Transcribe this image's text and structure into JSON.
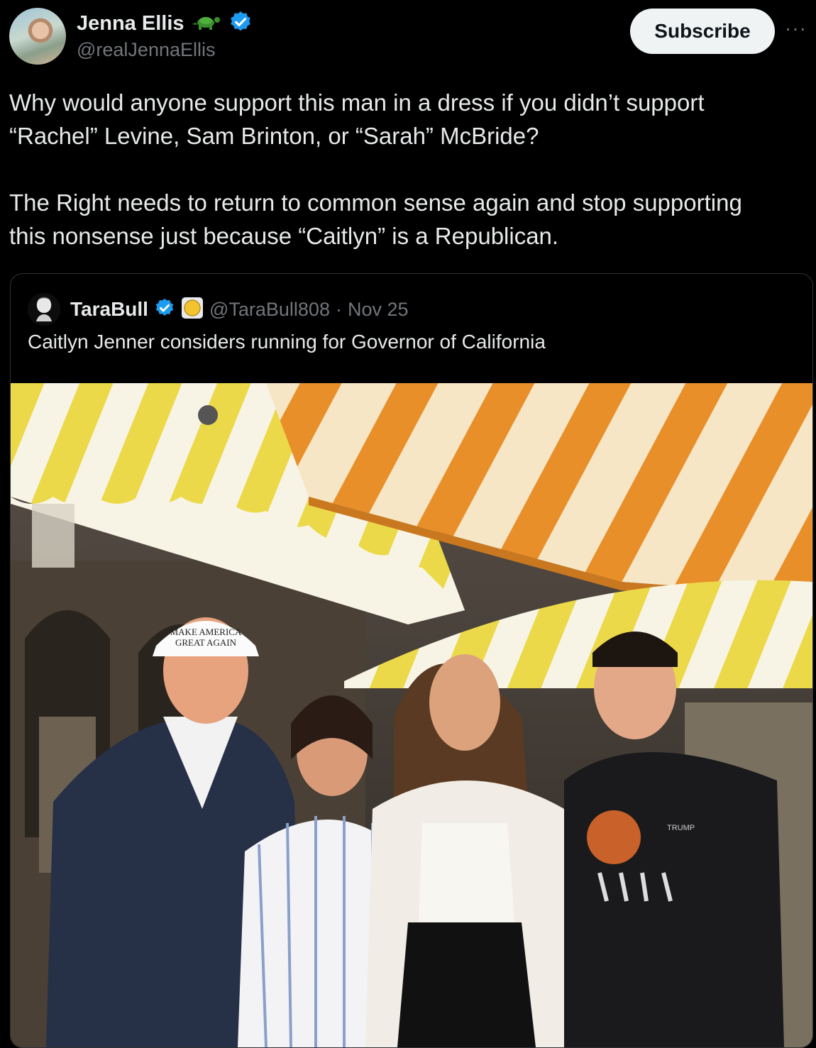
{
  "author": {
    "display_name": "Jenna Ellis",
    "handle": "@realJennaEllis",
    "badge_emoji_icon": "turtle-icon",
    "verified_icon": "verified-badge-icon"
  },
  "actions": {
    "subscribe_label": "Subscribe",
    "more_label": "···"
  },
  "tweet": {
    "text": "Why would anyone support this man in a dress if you didn’t support\n“Rachel” Levine, Sam Brinton, or “Sarah” McBride?\n\nThe Right needs to return to common sense again and stop supporting\nthis nonsense just because “Caitlyn” is a Republican."
  },
  "quoted": {
    "display_name": "TaraBull",
    "handle": "@TaraBull808",
    "separator": "·",
    "date": "Nov 25",
    "text": "Caitlyn Jenner considers running for Governor of California",
    "photo": {
      "hat_line1": "MAKE AMERICA",
      "hat_line2": "GREAT AGAIN",
      "shirt_print": "TRUMP"
    }
  },
  "colors": {
    "background": "#000000",
    "text": "#e7e9ea",
    "muted": "#71767b",
    "verified": "#1d9bf0",
    "button_bg": "#eff3f4",
    "border": "#2f3336"
  }
}
